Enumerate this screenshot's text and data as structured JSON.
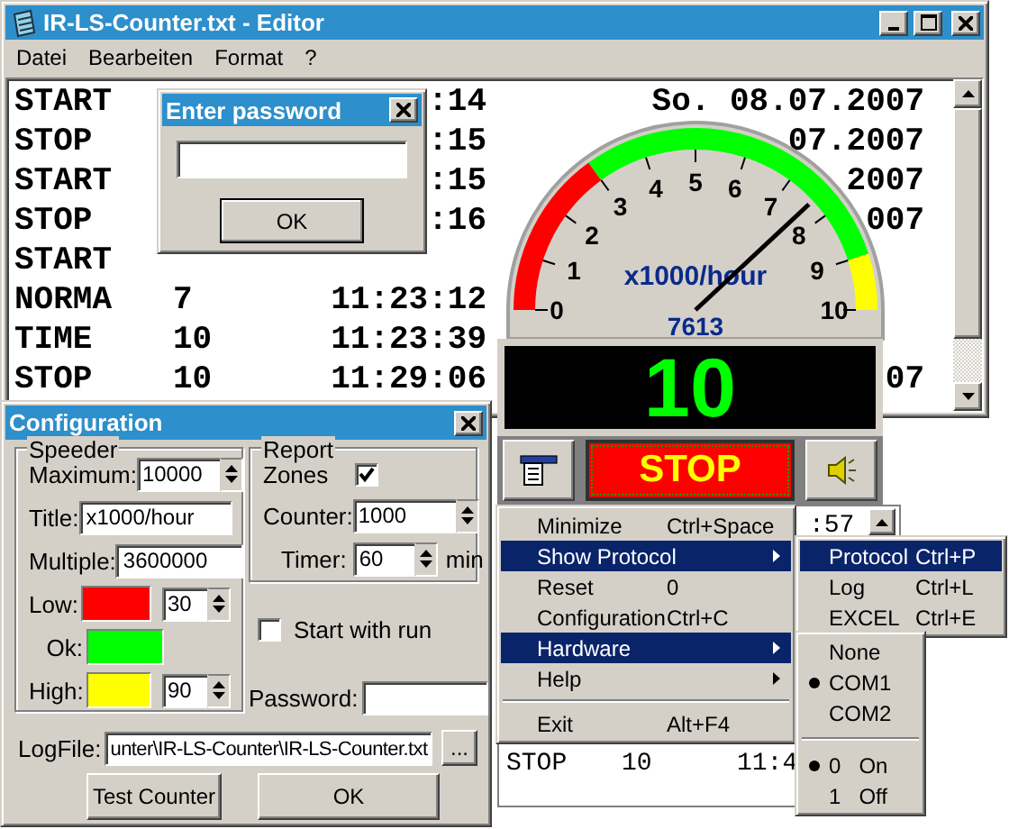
{
  "editor": {
    "title": "IR-LS-Counter.txt - Editor",
    "menu": [
      "Datei",
      "Bearbeiten",
      "Format",
      "?"
    ],
    "lines": [
      {
        "cells": [
          {
            "kind": "name",
            "text": "START"
          },
          {
            "kind": "time",
            "text": ":14"
          },
          {
            "kind": "date",
            "text": "So. 08.07.2007"
          }
        ]
      },
      {
        "cells": [
          {
            "kind": "name",
            "text": "STOP"
          },
          {
            "kind": "time",
            "text": ":15"
          },
          {
            "kind": "date",
            "text": "07.2007"
          }
        ]
      },
      {
        "cells": [
          {
            "kind": "name",
            "text": "START"
          },
          {
            "kind": "time",
            "text": ":15"
          },
          {
            "kind": "date",
            "text": "2007"
          }
        ]
      },
      {
        "cells": [
          {
            "kind": "name",
            "text": "STOP"
          },
          {
            "kind": "time",
            "text": ":16"
          },
          {
            "kind": "date",
            "text": "007"
          }
        ]
      },
      {
        "cells": [
          {
            "kind": "name",
            "text": "START"
          }
        ]
      },
      {
        "cells": [
          {
            "kind": "name",
            "text": "NORMA"
          },
          {
            "kind": "count",
            "text": "7"
          },
          {
            "kind": "time",
            "text": "11:23:12"
          }
        ]
      },
      {
        "cells": [
          {
            "kind": "name",
            "text": "TIME"
          },
          {
            "kind": "count",
            "text": "10"
          },
          {
            "kind": "time",
            "text": "11:23:39"
          }
        ]
      },
      {
        "cells": [
          {
            "kind": "name",
            "text": "STOP"
          },
          {
            "kind": "count",
            "text": "10"
          },
          {
            "kind": "time",
            "text": "11:29:06"
          },
          {
            "kind": "date",
            "text": "07"
          }
        ]
      }
    ]
  },
  "password_dialog": {
    "title": "Enter password",
    "button": "OK"
  },
  "gauge": {
    "scale": [
      "0",
      "1",
      "2",
      "3",
      "4",
      "5",
      "6",
      "7",
      "8",
      "9",
      "10"
    ],
    "unit": "x1000/hour",
    "reading": "7613"
  },
  "counter": {
    "value": "10"
  },
  "controls": {
    "stop": "STOP"
  },
  "protocol_view": {
    "top": ":57",
    "row": [
      "STOP",
      "10",
      "11:4"
    ]
  },
  "menu": [
    {
      "kind": "item",
      "label": "Minimize",
      "shortcut": "Ctrl+Space",
      "submenu": false,
      "selected": false
    },
    {
      "kind": "item",
      "label": "Show Protocol",
      "submenu": true,
      "selected": true
    },
    {
      "kind": "item",
      "label": "Reset",
      "shortcut": "0",
      "submenu": false,
      "selected": false
    },
    {
      "kind": "item",
      "label": "Configuration",
      "shortcut": "Ctrl+C",
      "submenu": false,
      "selected": false
    },
    {
      "kind": "item",
      "label": "Hardware",
      "submenu": true,
      "selected": true
    },
    {
      "kind": "item",
      "label": "Help",
      "submenu": true,
      "selected": false
    },
    {
      "kind": "separator"
    },
    {
      "kind": "item",
      "label": "Exit",
      "shortcut": "Alt+F4",
      "submenu": false,
      "selected": false
    }
  ],
  "protocol_submenu": [
    {
      "label": "Protocol",
      "shortcut": "Ctrl+P",
      "selected": true
    },
    {
      "label": "Log",
      "shortcut": "Ctrl+L",
      "selected": false
    },
    {
      "label": "EXCEL",
      "shortcut": "Ctrl+E",
      "selected": false
    }
  ],
  "hardware_submenu": [
    {
      "kind": "radio",
      "label": "None",
      "checked": false
    },
    {
      "kind": "radio",
      "label": "COM1",
      "checked": true
    },
    {
      "kind": "radio",
      "label": "COM2",
      "checked": false
    },
    {
      "kind": "separator"
    },
    {
      "kind": "radio",
      "label": "0",
      "shortcut": "On",
      "checked": true
    },
    {
      "kind": "radio",
      "label": "1",
      "shortcut": "Off",
      "checked": false
    }
  ],
  "configuration": {
    "title": "Configuration",
    "speeder": {
      "legend": "Speeder",
      "maximum": {
        "label": "Maximum:",
        "value": "10000"
      },
      "title": {
        "label": "Title:",
        "value": "x1000/hour"
      },
      "multiple": {
        "label": "Multiple:",
        "value": "3600000"
      },
      "zones": [
        {
          "label": "Low:",
          "color": "#ff0000",
          "value": "30"
        },
        {
          "label": "Ok:",
          "color": "#00ff00"
        },
        {
          "label": "High:",
          "color": "#ffff00",
          "value": "90"
        }
      ]
    },
    "report": {
      "legend": "Report",
      "zones": {
        "label": "Zones",
        "checked": true
      },
      "counter": {
        "label": "Counter:",
        "value": "1000"
      },
      "timer": {
        "label": "Timer:",
        "value": "60",
        "unit": "min"
      }
    },
    "start_with_run": {
      "label": "Start with run",
      "checked": false
    },
    "password": {
      "label": "Password:"
    },
    "logfile": {
      "label": "LogFile:",
      "value": "unter\\IR-LS-Counter\\IR-LS-Counter.txt",
      "browse": "..."
    },
    "buttons": [
      "Test Counter",
      "OK"
    ]
  }
}
